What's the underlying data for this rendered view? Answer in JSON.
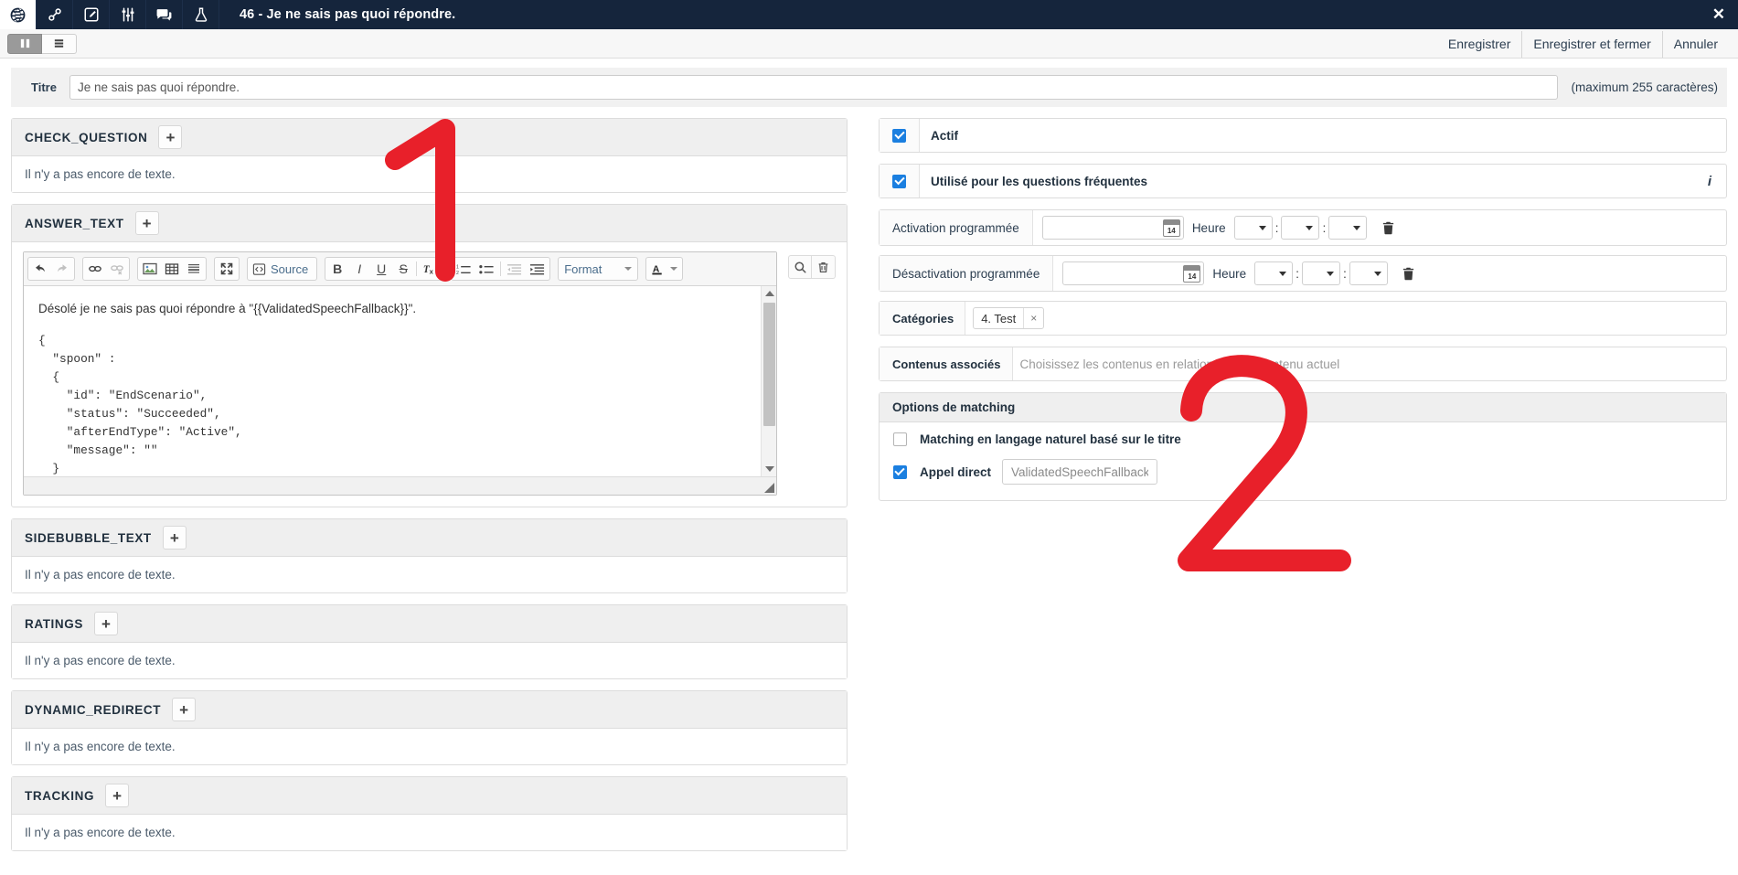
{
  "topnav": {
    "icons": [
      {
        "name": "globe-icon",
        "active": true
      },
      {
        "name": "link-chain-icon",
        "active": false
      },
      {
        "name": "edit-pencil-icon",
        "active": false
      },
      {
        "name": "sliders-icon",
        "active": false
      },
      {
        "name": "chat-bubbles-icon",
        "active": false
      },
      {
        "name": "flask-icon",
        "active": false
      }
    ],
    "title": "46 - Je ne sais pas quoi répondre.",
    "close_label": "✕"
  },
  "subbar": {
    "view_split_label": "view-split-icon",
    "view_list_label": "view-list-icon",
    "actions": [
      {
        "label": "Enregistrer"
      },
      {
        "label": "Enregistrer et fermer"
      },
      {
        "label": "Annuler"
      }
    ]
  },
  "titre": {
    "label": "Titre",
    "value": "Je ne sais pas quoi répondre.",
    "placeholder": "Je ne sais pas quoi répondre.",
    "hint": "(maximum 255 caractères)"
  },
  "empty_text": "Il n'y a pas encore de texte.",
  "sections": [
    {
      "title": "CHECK_QUESTION",
      "add": "+",
      "body": "Il n'y a pas encore de texte."
    },
    {
      "title": "ANSWER_TEXT",
      "add": "+"
    },
    {
      "title": "SIDEBUBBLE_TEXT",
      "add": "+",
      "body": "Il n'y a pas encore de texte."
    },
    {
      "title": "RATINGS",
      "add": "+",
      "body": "Il n'y a pas encore de texte."
    },
    {
      "title": "DYNAMIC_REDIRECT",
      "add": "+",
      "body": "Il n'y a pas encore de texte."
    },
    {
      "title": "TRACKING",
      "add": "+",
      "body": "Il n'y a pas encore de texte."
    }
  ],
  "editor": {
    "toolbar": {
      "undo": "undo-icon",
      "redo": "redo-icon",
      "link": "link-icon",
      "unlink": "unlink-icon",
      "image": "image-icon",
      "table": "table-icon",
      "hr": "horizontal-rule-icon",
      "maximize": "maximize-icon",
      "source_label": "Source",
      "bold": "B",
      "italic": "I",
      "underline": "U",
      "strike": "S",
      "remove_format": "Tx",
      "numbered_list": "numbered-list-icon",
      "bulleted_list": "bulleted-list-icon",
      "outdent": "outdent-icon",
      "indent": "indent-icon",
      "format_label": "Format",
      "text_color": "A"
    },
    "right_tools": {
      "search": "search-icon",
      "delete": "trash-icon"
    },
    "content_intro": "Désolé je ne sais pas quoi répondre à \"{{ValidatedSpeechFallback}}\".",
    "content_code": "{\n  \"spoon\" :\n  {\n    \"id\": \"EndScenario\",\n    \"status\": \"Succeeded\",\n    \"afterEndType\": \"Active\",\n    \"message\": \"\"\n  }"
  },
  "right": {
    "actif": {
      "label": "Actif",
      "checked": true
    },
    "faq": {
      "label": "Utilisé pour les questions fréquentes",
      "checked": true,
      "info": "i"
    },
    "schedule": [
      {
        "label": "Activation programmée",
        "date_value": "",
        "heure_label": "Heure",
        "hour": "",
        "minute": "",
        "second": "",
        "delete_icon": "trash-icon"
      },
      {
        "label": "Désactivation programmée",
        "date_value": "",
        "heure_label": "Heure",
        "hour": "",
        "minute": "",
        "second": "",
        "delete_icon": "trash-icon"
      }
    ],
    "categories": {
      "label": "Catégories",
      "tags": [
        {
          "text": "4. Test",
          "remove": "×"
        }
      ]
    },
    "contenus": {
      "label": "Contenus associés",
      "placeholder": "Choisissez les contenus en relation avec le contenu actuel",
      "value": ""
    },
    "matching": {
      "title": "Options de matching",
      "natural": {
        "label": "Matching en langage naturel basé sur le titre",
        "checked": false
      },
      "direct": {
        "label": "Appel direct",
        "checked": true,
        "value": "ValidatedSpeechFallback",
        "placeholder": "ValidatedSpeechFallback"
      }
    }
  },
  "annotations": {
    "marker_one": "1",
    "marker_two": "2",
    "color": "#e8202a"
  },
  "colors": {
    "nav_bg": "#15253c",
    "accent": "#1b7fe0",
    "panel_head": "#efefef",
    "annotation_red": "#e8202a"
  }
}
